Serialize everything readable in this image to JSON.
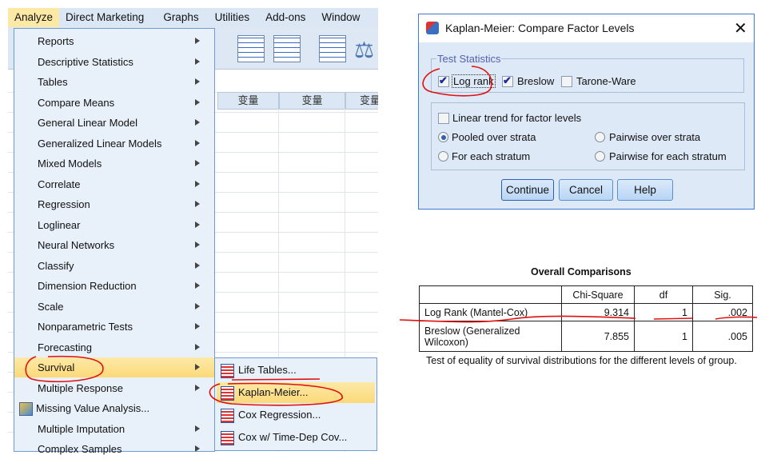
{
  "menubar": [
    "Analyze",
    "Direct Marketing",
    "Graphs",
    "Utilities",
    "Add-ons",
    "Window"
  ],
  "grid": {
    "col_header": "变量"
  },
  "menu": {
    "items": [
      {
        "label": "Reports",
        "sub": true
      },
      {
        "label": "Descriptive Statistics",
        "sub": true
      },
      {
        "label": "Tables",
        "sub": true
      },
      {
        "label": "Compare Means",
        "sub": true
      },
      {
        "label": "General Linear Model",
        "sub": true
      },
      {
        "label": "Generalized Linear Models",
        "sub": true
      },
      {
        "label": "Mixed Models",
        "sub": true
      },
      {
        "label": "Correlate",
        "sub": true
      },
      {
        "label": "Regression",
        "sub": true
      },
      {
        "label": "Loglinear",
        "sub": true
      },
      {
        "label": "Neural Networks",
        "sub": true
      },
      {
        "label": "Classify",
        "sub": true
      },
      {
        "label": "Dimension Reduction",
        "sub": true
      },
      {
        "label": "Scale",
        "sub": true
      },
      {
        "label": "Nonparametric Tests",
        "sub": true
      },
      {
        "label": "Forecasting",
        "sub": true
      },
      {
        "label": "Survival",
        "sub": true,
        "highlighted": true
      },
      {
        "label": "Multiple Response",
        "sub": true
      },
      {
        "label": "Missing Value Analysis...",
        "sub": false,
        "icon": "missing-value-icon"
      },
      {
        "label": "Multiple Imputation",
        "sub": true
      },
      {
        "label": "Complex Samples",
        "sub": true
      }
    ]
  },
  "submenu": {
    "items": [
      {
        "label": "Life Tables..."
      },
      {
        "label": "Kaplan-Meier...",
        "highlighted": true
      },
      {
        "label": "Cox Regression..."
      },
      {
        "label": "Cox w/ Time-Dep Cov..."
      }
    ]
  },
  "dialog": {
    "title": "Kaplan-Meier: Compare Factor Levels",
    "group_label": "Test Statistics",
    "log_rank": {
      "label": "Log rank",
      "checked": true
    },
    "breslow": {
      "label": "Breslow",
      "checked": true
    },
    "tarone": {
      "label": "Tarone-Ware",
      "checked": false
    },
    "linear_trend": {
      "label": "Linear trend for factor levels",
      "checked": false
    },
    "radios": {
      "pooled": "Pooled over strata",
      "each": "For each stratum",
      "pairwise": "Pairwise over strata",
      "pairwise_each": "Pairwise for each stratum",
      "selected": "Pooled over strata"
    },
    "buttons": {
      "continue": "Continue",
      "cancel": "Cancel",
      "help": "Help"
    }
  },
  "output": {
    "title": "Overall Comparisons",
    "headers": [
      "",
      "Chi-Square",
      "df",
      "Sig."
    ],
    "rows": [
      [
        "Log Rank (Mantel-Cox)",
        "9.314",
        "1",
        ".002"
      ],
      [
        "Breslow (Generalized Wilcoxon)",
        "7.855",
        "1",
        ".005"
      ]
    ],
    "footnote": "Test of equality of survival distributions for the different levels of group."
  },
  "colors": {
    "annotation": "#e01010",
    "highlight": "#fbd97a",
    "menu_bg": "#e8f0fa"
  }
}
